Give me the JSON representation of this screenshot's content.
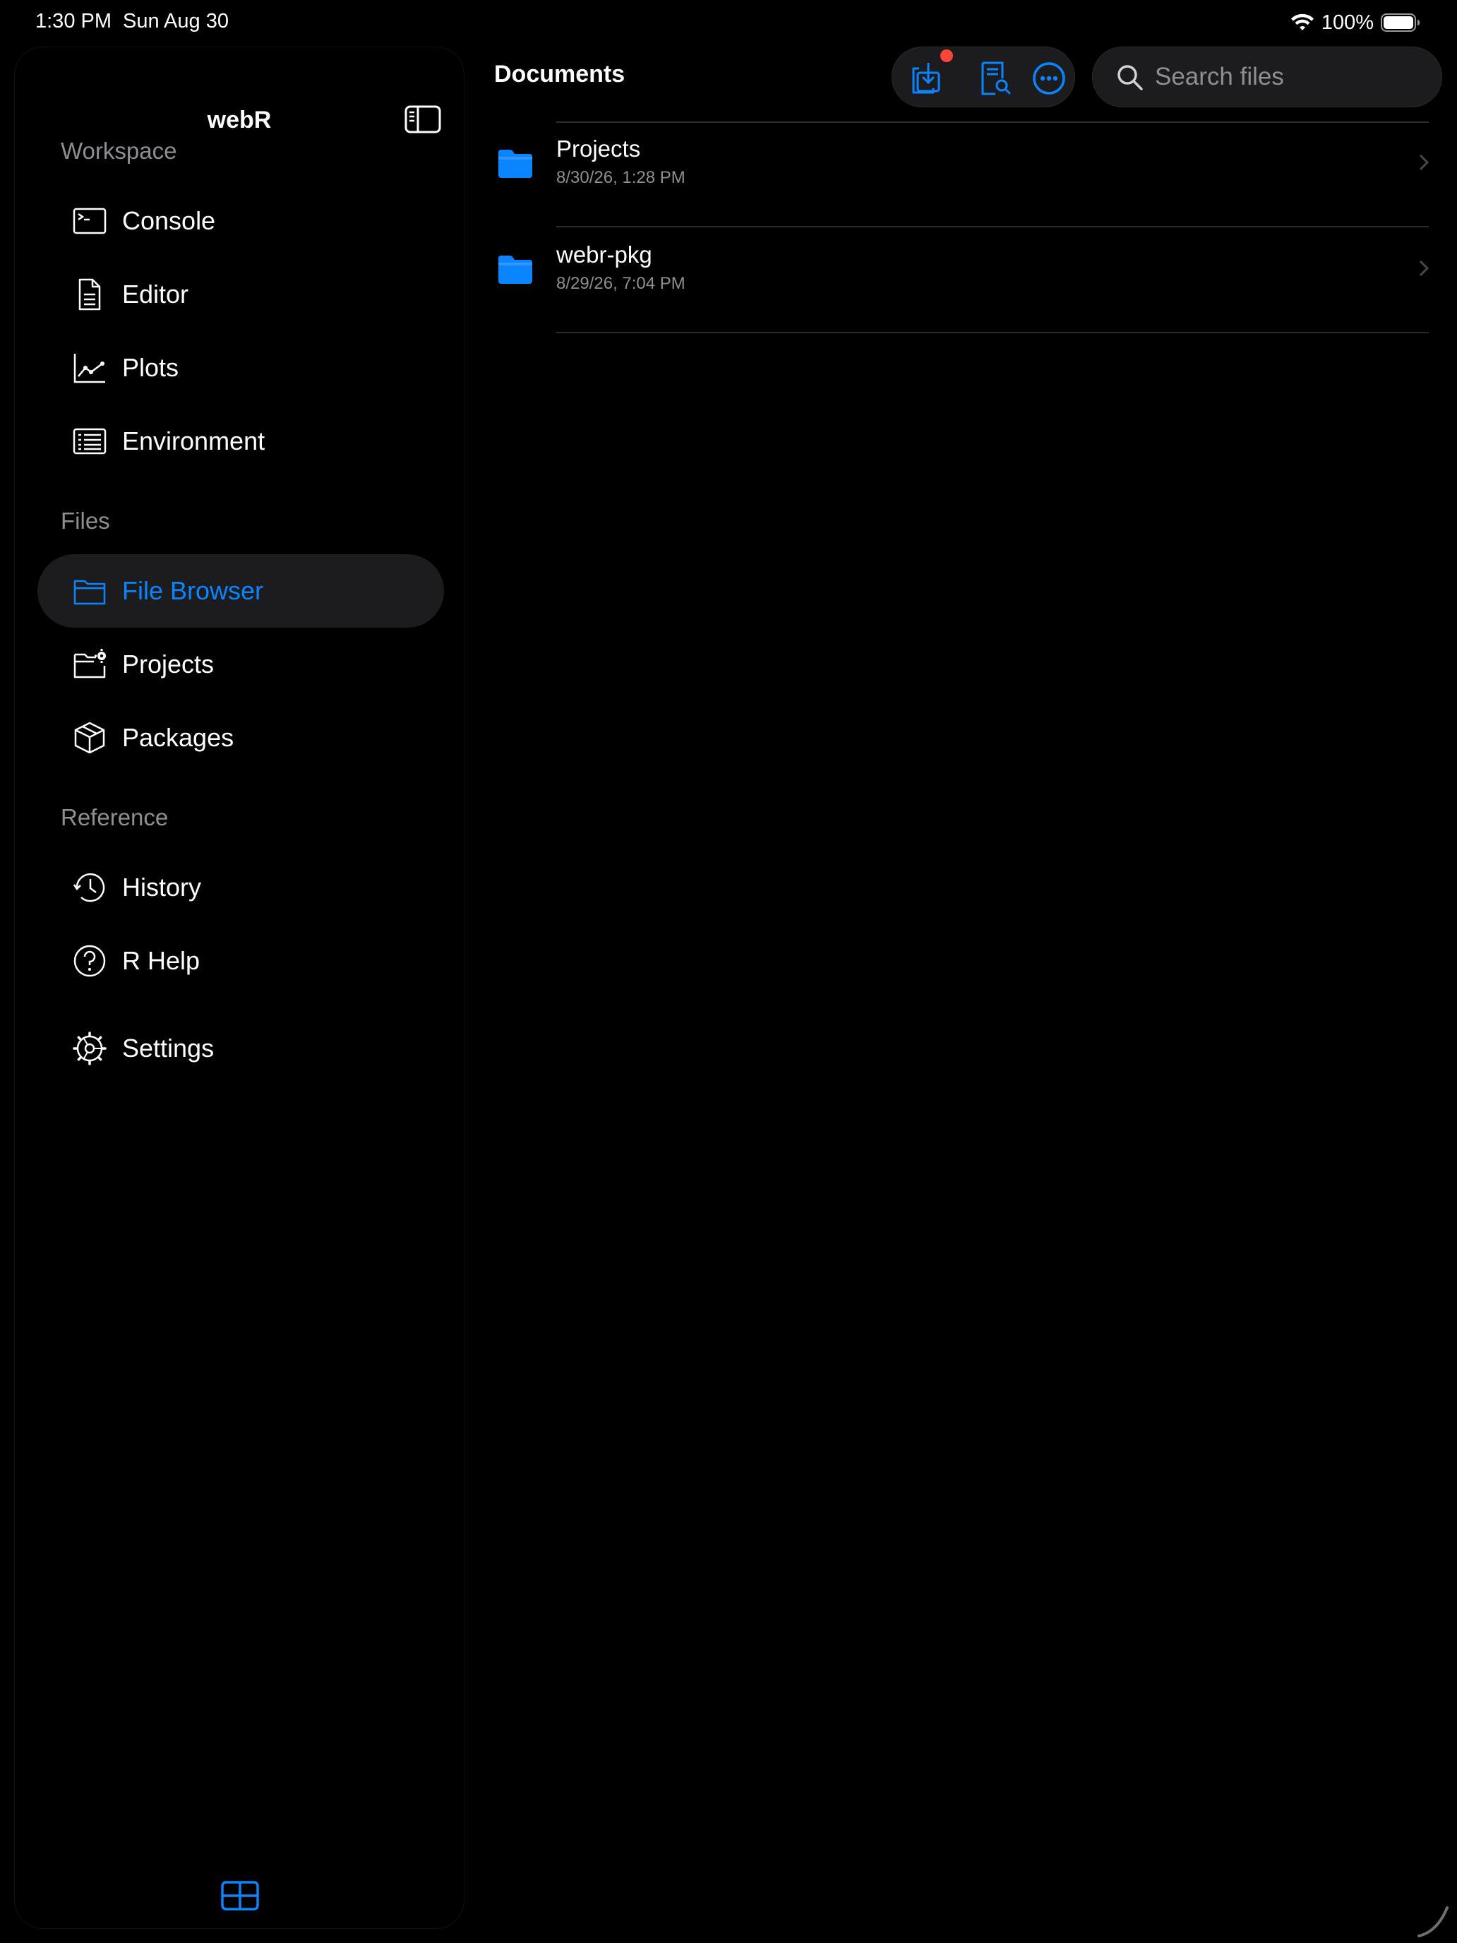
{
  "status_bar": {
    "time": "1:30 PM",
    "date": "Sun Aug 30",
    "battery": "100%"
  },
  "sidebar": {
    "title": "webR",
    "sections": {
      "workspace": "Workspace",
      "files": "Files",
      "reference": "Reference"
    },
    "items": {
      "console": "Console",
      "editor": "Editor",
      "plots": "Plots",
      "environment": "Environment",
      "file_browser": "File Browser",
      "projects": "Projects",
      "packages": "Packages",
      "history": "History",
      "r_help": "R Help",
      "settings": "Settings"
    },
    "active_item": "file_browser"
  },
  "main": {
    "title": "Documents",
    "search": {
      "placeholder": "Search files"
    },
    "files": [
      {
        "name": "Projects",
        "date": "8/30/26, 1:28 PM"
      },
      {
        "name": "webr-pkg",
        "date": "8/29/26, 7:04 PM"
      }
    ]
  },
  "colors": {
    "accent": "#0a84ff",
    "folder": "#0a84ff",
    "badge": "#ff453a",
    "background": "#000000",
    "panel": "#1c1c1e",
    "secondary_text": "#8e8e93"
  },
  "icons": {
    "sidebar_toggle": "sidebar-toggle-icon",
    "import": "import-icon",
    "find_in_document": "document-search-icon",
    "more": "more-ellipsis-icon",
    "search": "search-icon",
    "grid": "grid-layout-icon"
  }
}
